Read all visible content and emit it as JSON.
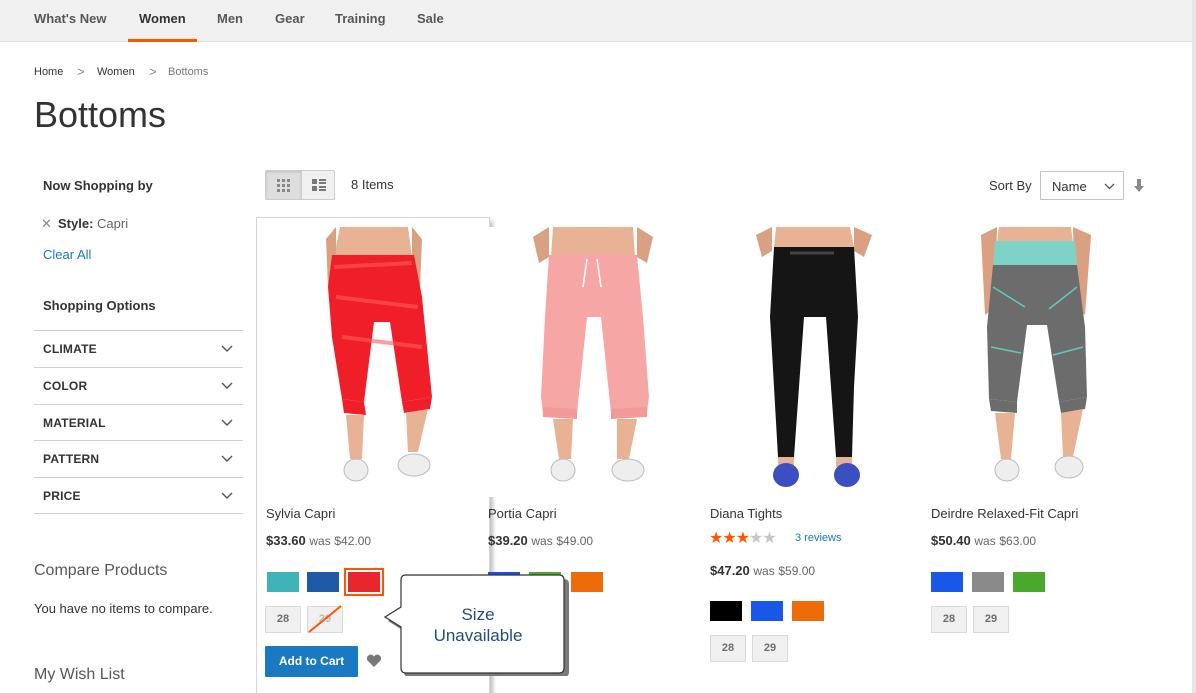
{
  "nav": {
    "items": [
      "What's New",
      "Women",
      "Men",
      "Gear",
      "Training",
      "Sale"
    ],
    "active": "Women"
  },
  "breadcrumb": {
    "home": "Home",
    "women": "Women",
    "current": "Bottoms",
    "separator": ">"
  },
  "page_title": "Bottoms",
  "sidebar": {
    "now_shopping_title": "Now Shopping by",
    "active_filter": {
      "label": "Style:",
      "value": "Capri"
    },
    "clear_all": "Clear All",
    "shopping_options_title": "Shopping Options",
    "options": [
      "CLIMATE",
      "COLOR",
      "MATERIAL",
      "PATTERN",
      "PRICE"
    ],
    "compare_title": "Compare Products",
    "compare_text": "You have no items to compare.",
    "wishlist_title": "My Wish List"
  },
  "toolbar": {
    "items_count": "8 Items",
    "sort_label": "Sort By",
    "sort_value": "Name"
  },
  "products": [
    {
      "name": "Sylvia Capri",
      "price": "$33.60",
      "was_label": "was",
      "was": "$42.00",
      "colors": [
        "#3fb3b8",
        "#1d5aa8",
        "#e8262e"
      ],
      "sizes": [
        "28",
        "29"
      ],
      "add_to_cart": "Add to Cart"
    },
    {
      "name": "Portia Capri",
      "price": "$39.20",
      "was_label": "was",
      "was": "$49.00",
      "colors": [
        "#1f4fd8",
        "#4ba82f",
        "#ee6b09"
      ]
    },
    {
      "name": "Diana Tights",
      "reviews": "3 reviews",
      "rating_stars": 3.5,
      "price": "$47.20",
      "was_label": "was",
      "was": "$59.00",
      "colors": [
        "#000000",
        "#1857e8",
        "#ee6b09"
      ],
      "sizes": [
        "28",
        "29"
      ]
    },
    {
      "name": "Deirdre Relaxed-Fit Capri",
      "price": "$50.40",
      "was_label": "was",
      "was": "$63.00",
      "colors": [
        "#1857e8",
        "#8a8a8a",
        "#4aa92c"
      ],
      "sizes": [
        "28",
        "29"
      ]
    }
  ],
  "callout": {
    "line1": "Size",
    "line2": "Unavailable"
  },
  "colors": {
    "accent": "#ff5501",
    "link": "#1979c3",
    "star": "#ff5501"
  }
}
